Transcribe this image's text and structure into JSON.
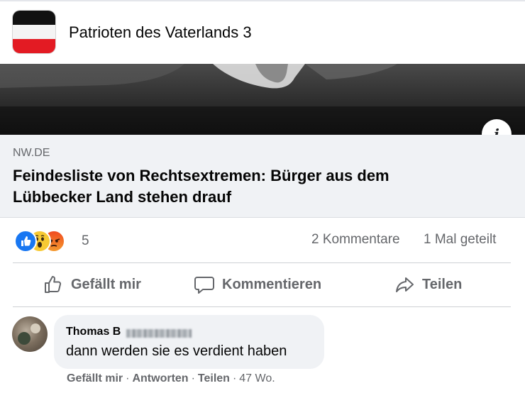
{
  "group": {
    "name": "Patrioten des Vaterlands 3",
    "flag_colors": [
      "#111111",
      "#f4f4f4",
      "#e31b23"
    ]
  },
  "link": {
    "domain": "NW.DE",
    "title": "Feindesliste von Rechtsextremen: Bürger aus dem Lübbecker Land stehen drauf",
    "info_icon": "info-icon"
  },
  "stats": {
    "reactions": [
      "like",
      "wow",
      "angry"
    ],
    "reaction_count": "5",
    "comments": "2 Kommentare",
    "shares": "1 Mal geteilt"
  },
  "actions": {
    "like": "Gefällt mir",
    "comment": "Kommentieren",
    "share": "Teilen"
  },
  "comment": {
    "author": "Thomas B",
    "text": "dann werden sie es verdient haben",
    "like": "Gefällt mir",
    "reply": "Antworten",
    "share": "Teilen",
    "separator": "·",
    "time": "47 Wo."
  },
  "colors": {
    "meta_text": "#65676b",
    "like_blue": "#1877f2",
    "wow_yellow": "#f7c933",
    "angry_orange": "#f04a1f"
  }
}
